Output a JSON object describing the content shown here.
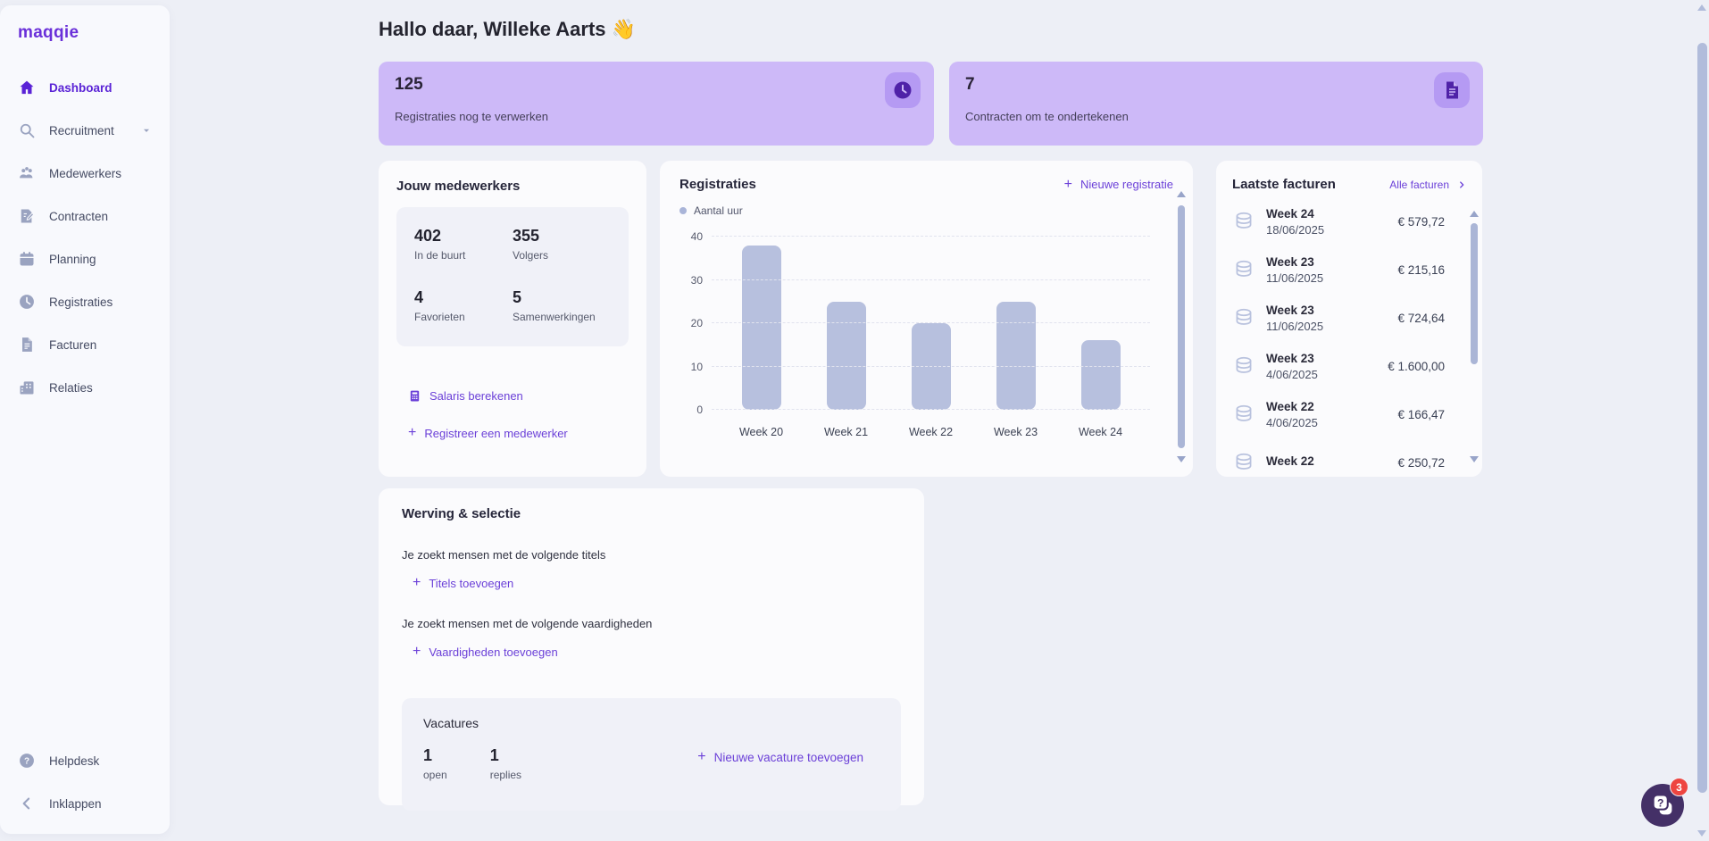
{
  "colors": {
    "brand_purple": "#6a30d9",
    "link_purple": "#6b40d8",
    "summary_bg": "#cdb9f8",
    "chip_bg": "#b59af3",
    "chip_glyph": "#4f22a8",
    "bar_fill": "#b7c0de",
    "page_bg": "#edeff6",
    "card_bg": "#fbfbfd",
    "badge_red": "#ee4540",
    "chat_bg": "#443067"
  },
  "sidebar": {
    "logo": "maqqie",
    "items": [
      {
        "label": "Dashboard",
        "icon": "home-icon",
        "active": true
      },
      {
        "label": "Recruitment",
        "icon": "search-icon",
        "chevron": true
      },
      {
        "label": "Medewerkers",
        "icon": "users-icon"
      },
      {
        "label": "Contracten",
        "icon": "contract-icon"
      },
      {
        "label": "Planning",
        "icon": "calendar-icon"
      },
      {
        "label": "Registraties",
        "icon": "clock-icon"
      },
      {
        "label": "Facturen",
        "icon": "invoice-icon"
      },
      {
        "label": "Relaties",
        "icon": "building-icon"
      }
    ],
    "footer_items": [
      {
        "label": "Helpdesk",
        "icon": "help-icon"
      },
      {
        "label": "Inklappen",
        "icon": "chevron-left-icon"
      }
    ]
  },
  "header": {
    "greeting": "Hallo daar, Willeke Aarts",
    "emoji": "👋"
  },
  "summary_cards": [
    {
      "value": "125",
      "label": "Registraties nog te verwerken",
      "icon": "clock-chip-icon"
    },
    {
      "value": "7",
      "label": "Contracten om te ondertekenen",
      "icon": "document-chip-icon"
    }
  ],
  "medewerkers": {
    "title": "Jouw medewerkers",
    "stats": [
      {
        "value": "402",
        "label": "In de buurt"
      },
      {
        "value": "355",
        "label": "Volgers"
      },
      {
        "value": "4",
        "label": "Favorieten"
      },
      {
        "value": "5",
        "label": "Samenwerkingen"
      }
    ],
    "links": [
      {
        "label": "Salaris berekenen",
        "icon": "calculator-icon"
      },
      {
        "label": "Registreer een medewerker",
        "icon": "plus-icon"
      }
    ]
  },
  "registraties_card": {
    "title": "Registraties",
    "action_plus": "+",
    "action_label": "Nieuwe registratie",
    "legend": "Aantal uur"
  },
  "chart_data": {
    "type": "bar",
    "title": "Registraties",
    "series_name": "Aantal uur",
    "categories": [
      "Week 20",
      "Week 21",
      "Week 22",
      "Week 23",
      "Week 24"
    ],
    "values": [
      38,
      25,
      20,
      25,
      16
    ],
    "ylim": [
      0,
      40
    ],
    "yticks": [
      0,
      10,
      20,
      30,
      40
    ],
    "xlabel": "",
    "ylabel": "",
    "grid": "horizontal-dashed",
    "legend_position": "top-left"
  },
  "facturen": {
    "title": "Laatste facturen",
    "action_label": "Alle facturen",
    "rows": [
      {
        "week": "Week 24",
        "date": "18/06/2025",
        "amount": "€ 579,72"
      },
      {
        "week": "Week 23",
        "date": "11/06/2025",
        "amount": "€ 215,16"
      },
      {
        "week": "Week 23",
        "date": "11/06/2025",
        "amount": "€ 724,64"
      },
      {
        "week": "Week 23",
        "date": "4/06/2025",
        "amount": "€ 1.600,00"
      },
      {
        "week": "Week 22",
        "date": "4/06/2025",
        "amount": "€ 166,47"
      },
      {
        "week": "Week 22",
        "date": "",
        "amount": "€ 250,72"
      }
    ]
  },
  "werving": {
    "title": "Werving & selectie",
    "titles_text": "Je zoekt mensen met de volgende titels",
    "titles_action": "Titels toevoegen",
    "skills_text": "Je zoekt mensen met de volgende vaardigheden",
    "skills_action": "Vaardigheden toevoegen",
    "vacatures": {
      "title": "Vacatures",
      "stats": [
        {
          "value": "1",
          "label": "open"
        },
        {
          "value": "1",
          "label": "replies"
        }
      ],
      "action_label": "Nieuwe vacature toevoegen"
    }
  },
  "chat_widget": {
    "badge_count": "3"
  }
}
